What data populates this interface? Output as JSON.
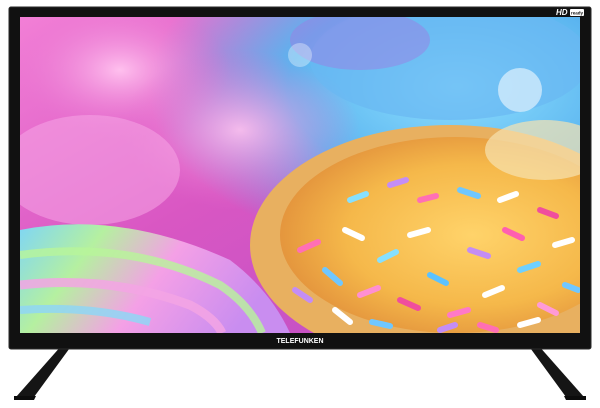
{
  "product": {
    "brand": "TELEFUNKEN",
    "badge_main": "HD",
    "badge_sub": "ready"
  },
  "colors": {
    "bezel": "#111111",
    "bezel_edge": "#2a2a2a",
    "stand": "#151515",
    "screen_pink": "#e85fc6",
    "screen_blue": "#6ec7f0",
    "donut_yellow": "#f3c64a",
    "background": "#ffffff"
  }
}
